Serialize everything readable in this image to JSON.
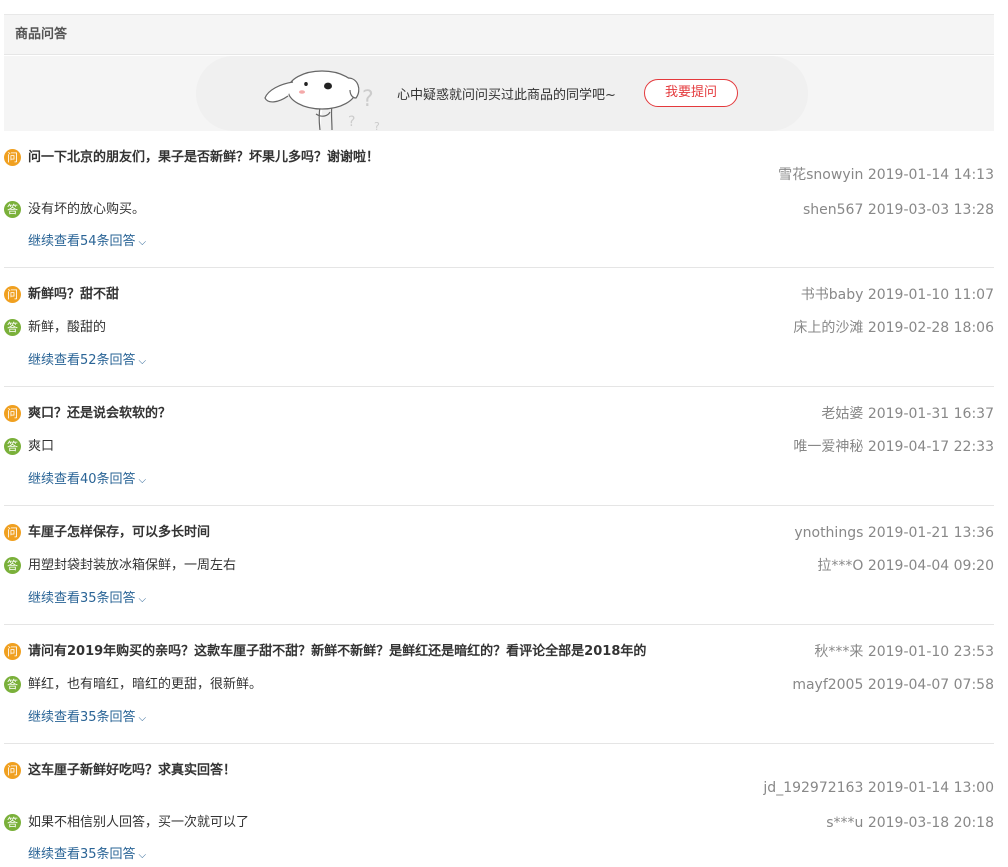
{
  "section": {
    "title": "商品问答"
  },
  "banner": {
    "prompt": "心中疑惑就问问买过此商品的同学吧~",
    "ask_button": "我要提问"
  },
  "badges": {
    "question": "问",
    "answer": "答"
  },
  "chevron": "⌵",
  "colors": {
    "question_badge": "#f0a020",
    "answer_badge": "#7ab03a",
    "accent": "#e4393c",
    "link": "#2a6496"
  },
  "items": [
    {
      "question": "问一下北京的朋友们，果子是否新鲜？坏果儿多吗？谢谢啦！",
      "asker": "雪花snowyin",
      "asked_at": "2019-01-14 14:13",
      "answer": "没有坏的放心购买。",
      "answerer": "shen567",
      "answered_at": "2019-03-03 13:28",
      "more": "继续查看54条回答"
    },
    {
      "question": "新鲜吗？甜不甜",
      "asker": "书书baby",
      "asked_at": "2019-01-10 11:07",
      "answer": "新鲜，酸甜的",
      "answerer": "床上的沙滩",
      "answered_at": "2019-02-28 18:06",
      "more": "继续查看52条回答"
    },
    {
      "question": "爽口？还是说会软软的？",
      "asker": "老姑婆",
      "asked_at": "2019-01-31 16:37",
      "answer": "爽口",
      "answerer": "唯一爱神秘",
      "answered_at": "2019-04-17 22:33",
      "more": "继续查看40条回答"
    },
    {
      "question": "车厘子怎样保存，可以多长时间",
      "asker": "ynothings",
      "asked_at": "2019-01-21 13:36",
      "answer": "用塑封袋封装放冰箱保鲜，一周左右",
      "answerer": "拉***O",
      "answered_at": "2019-04-04 09:20",
      "more": "继续查看35条回答"
    },
    {
      "question": "请问有2019年购买的亲吗？这款车厘子甜不甜？新鲜不新鲜？是鲜红还是暗红的？看评论全部是2018年的",
      "asker": "秋***来",
      "asked_at": "2019-01-10 23:53",
      "answer": "鲜红，也有暗红，暗红的更甜，很新鲜。",
      "answerer": "mayf2005",
      "answered_at": "2019-04-07 07:58",
      "more": "继续查看35条回答"
    },
    {
      "question": "这车厘子新鲜好吃吗？求真实回答！",
      "asker": "jd_192972163",
      "asked_at": "2019-01-14 13:00",
      "answer": "如果不相信别人回答，买一次就可以了",
      "answerer": "s***u",
      "answered_at": "2019-03-18 20:18",
      "more": "继续查看35条回答"
    }
  ]
}
